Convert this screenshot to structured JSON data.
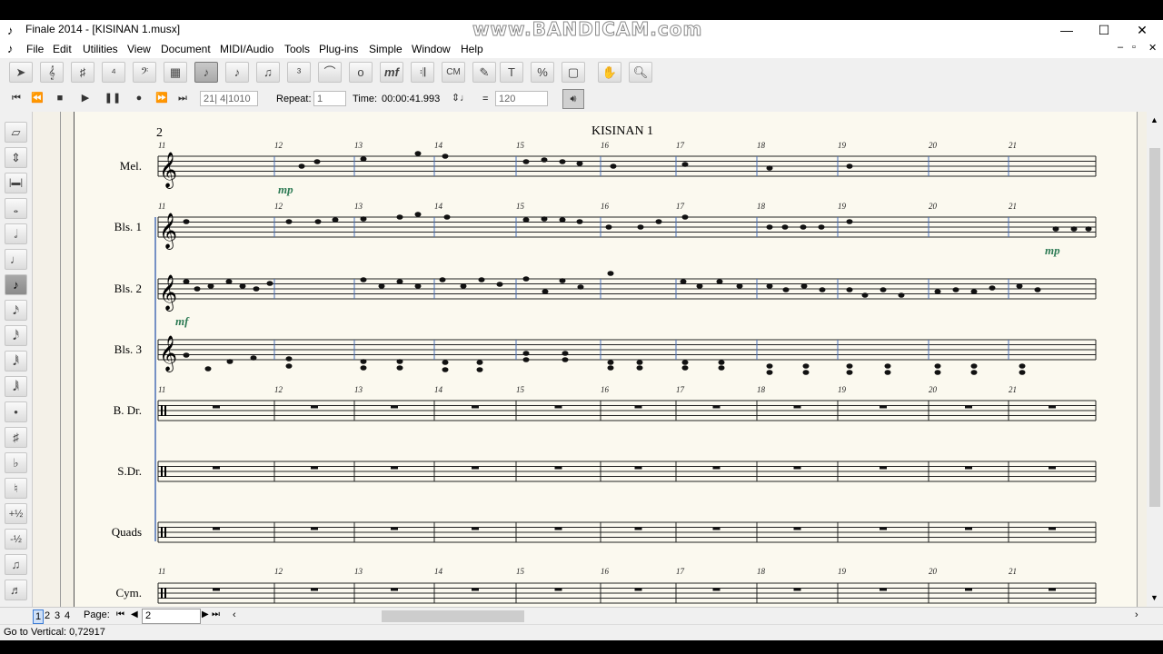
{
  "window": {
    "title": "Finale 2014 - [KISINAN 1.musx]",
    "watermark": "www.BANDICAM.com",
    "controls": {
      "minimize": "—",
      "maximize": "☐",
      "close": "✕"
    }
  },
  "menu": [
    "File",
    "Edit",
    "Utilities",
    "View",
    "Document",
    "MIDI/Audio",
    "Tools",
    "Plug-ins",
    "Simple",
    "Window",
    "Help"
  ],
  "playback": {
    "counter": "21| 4|1010",
    "repeat_label": "Repeat:",
    "repeat_value": "1",
    "time_label": "Time:",
    "time_value": "00:00:41.993",
    "equals": "=",
    "tempo": "120"
  },
  "score": {
    "page_number": "2",
    "title": "KISINAN 1",
    "measure_numbers": [
      "11",
      "12",
      "13",
      "14",
      "15",
      "16",
      "17",
      "18",
      "19",
      "20",
      "21"
    ],
    "instruments": [
      "Mel.",
      "Bls. 1",
      "Bls. 2",
      "Bls. 3",
      "B. Dr.",
      "S.Dr.",
      "Quads",
      "Cym."
    ],
    "dynamics": {
      "mel": "mp",
      "bls1": "mp",
      "bls2": "mf"
    }
  },
  "pager": {
    "pages": [
      "1",
      "2",
      "3",
      "4"
    ],
    "label": "Page:",
    "current": "2"
  },
  "status": "Go to Vertical: 0,72917",
  "left_palette_icons": [
    "eraser-icon",
    "tuplet-tool-icon",
    "measure-rest-icon",
    "whole-note-icon",
    "half-note-icon",
    "quarter-note-icon",
    "eighth-note-icon",
    "sixteenth-note-icon",
    "thirtysecond-note-icon",
    "sixtyfourth-note-icon",
    "128th-note-icon",
    "dot-icon",
    "sharp-icon",
    "flat-icon",
    "natural-icon",
    "half-step-up-icon",
    "half-step-down-icon",
    "tie-icon",
    "grace-note-icon",
    "rest-icon"
  ]
}
